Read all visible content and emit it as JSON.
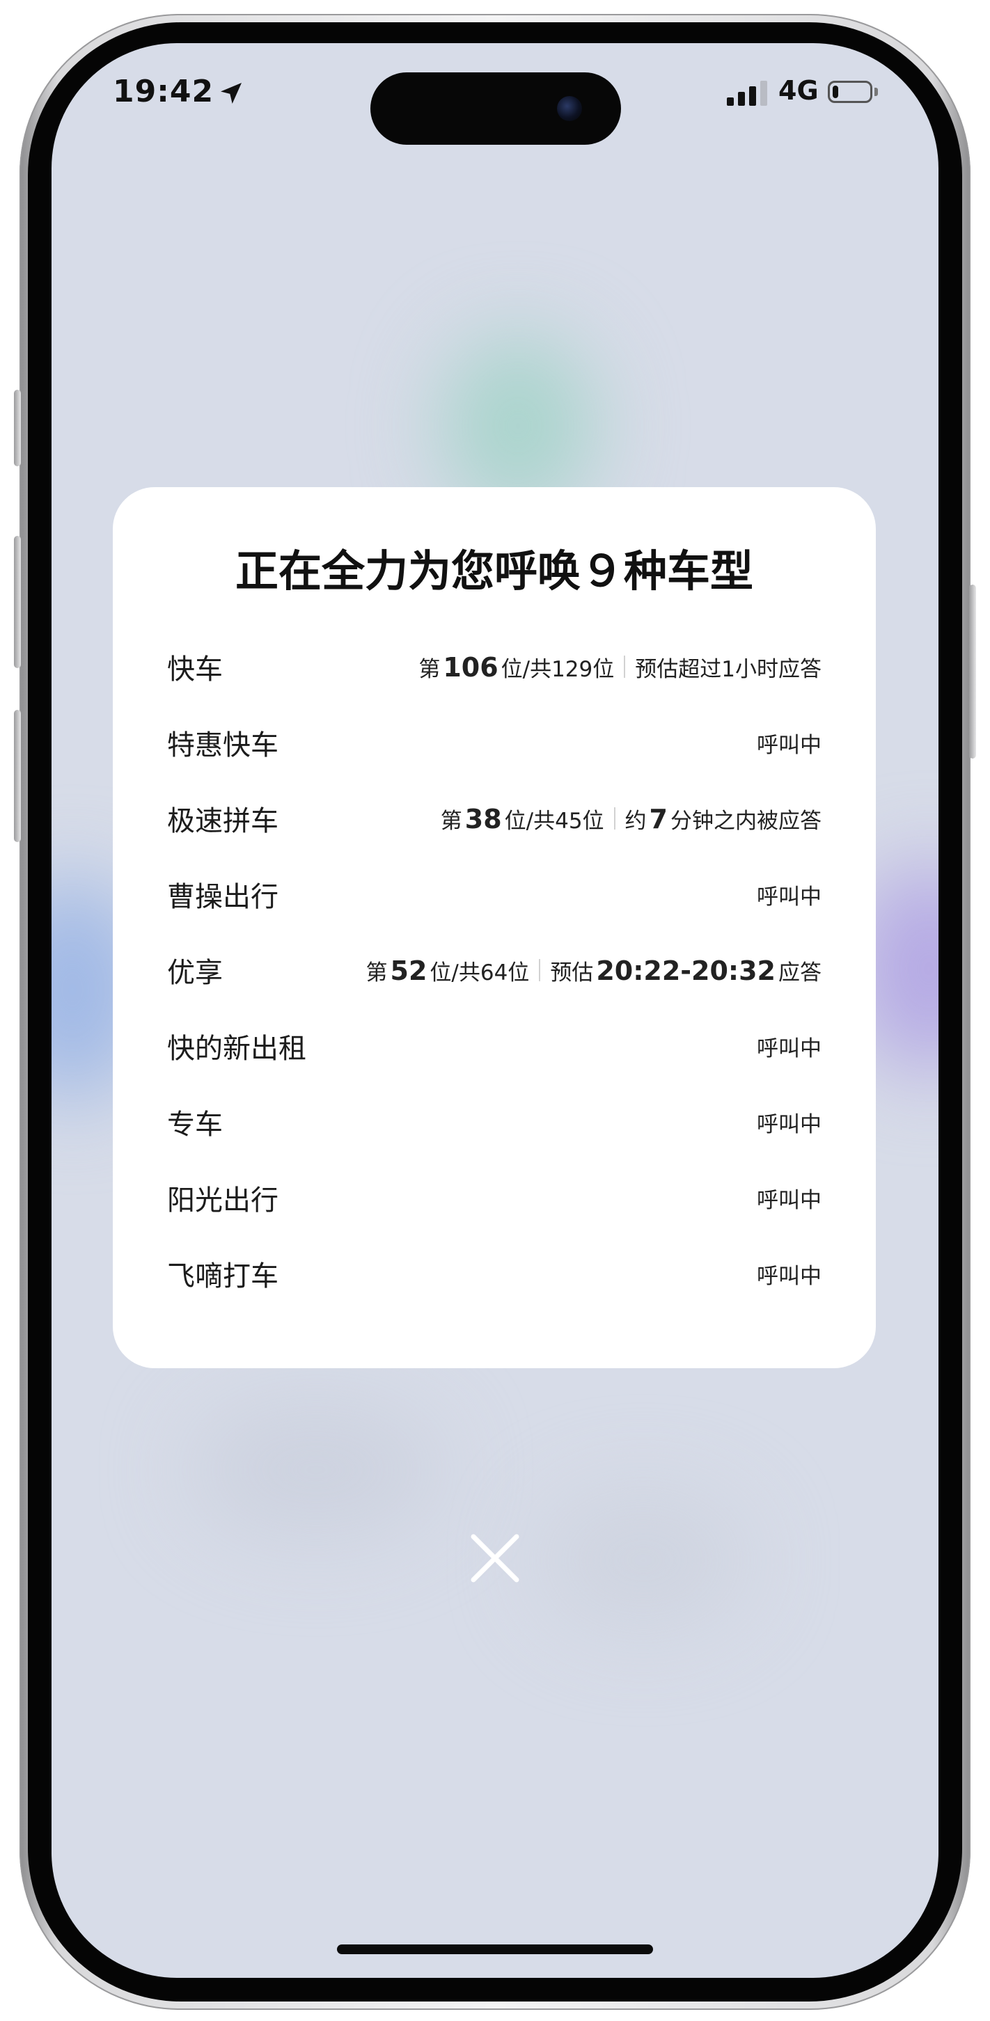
{
  "status_bar": {
    "time": "19:42",
    "network": "4G",
    "battery_level": 0.15,
    "signal_bars": 3
  },
  "dialog": {
    "title": "正在全力为您呼唤９种车型",
    "rows": [
      {
        "name": "快车",
        "parts": [
          {
            "text": "第",
            "kind": "text"
          },
          {
            "text": "106",
            "kind": "big"
          },
          {
            "text": "位/共129位",
            "kind": "text"
          },
          {
            "kind": "sep"
          },
          {
            "text": "预估超过1小时应答",
            "kind": "text"
          }
        ]
      },
      {
        "name": "特惠快车",
        "parts": [
          {
            "text": "呼叫中",
            "kind": "text"
          }
        ]
      },
      {
        "name": "极速拼车",
        "parts": [
          {
            "text": "第",
            "kind": "text"
          },
          {
            "text": "38",
            "kind": "big"
          },
          {
            "text": "位/共45位",
            "kind": "text"
          },
          {
            "kind": "sep"
          },
          {
            "text": "约",
            "kind": "text"
          },
          {
            "text": "7",
            "kind": "big"
          },
          {
            "text": "分钟之内被应答",
            "kind": "text"
          }
        ]
      },
      {
        "name": "曹操出行",
        "parts": [
          {
            "text": "呼叫中",
            "kind": "text"
          }
        ]
      },
      {
        "name": "优享",
        "parts": [
          {
            "text": "第",
            "kind": "text"
          },
          {
            "text": "52",
            "kind": "big"
          },
          {
            "text": "位/共64位",
            "kind": "text"
          },
          {
            "kind": "sep"
          },
          {
            "text": "预估",
            "kind": "text"
          },
          {
            "text": "20:22-20:32",
            "kind": "big"
          },
          {
            "text": "应答",
            "kind": "text"
          }
        ]
      },
      {
        "name": "快的新出租",
        "parts": [
          {
            "text": "呼叫中",
            "kind": "text"
          }
        ]
      },
      {
        "name": "专车",
        "parts": [
          {
            "text": "呼叫中",
            "kind": "text"
          }
        ]
      },
      {
        "name": "阳光出行",
        "parts": [
          {
            "text": "呼叫中",
            "kind": "text"
          }
        ]
      },
      {
        "name": "飞嘀打车",
        "parts": [
          {
            "text": "呼叫中",
            "kind": "text"
          }
        ]
      }
    ]
  },
  "close_icon": "close-icon",
  "colors": {
    "screen_bg": "#d7dce8",
    "card_bg": "#ffffff",
    "text_primary": "#111111"
  }
}
